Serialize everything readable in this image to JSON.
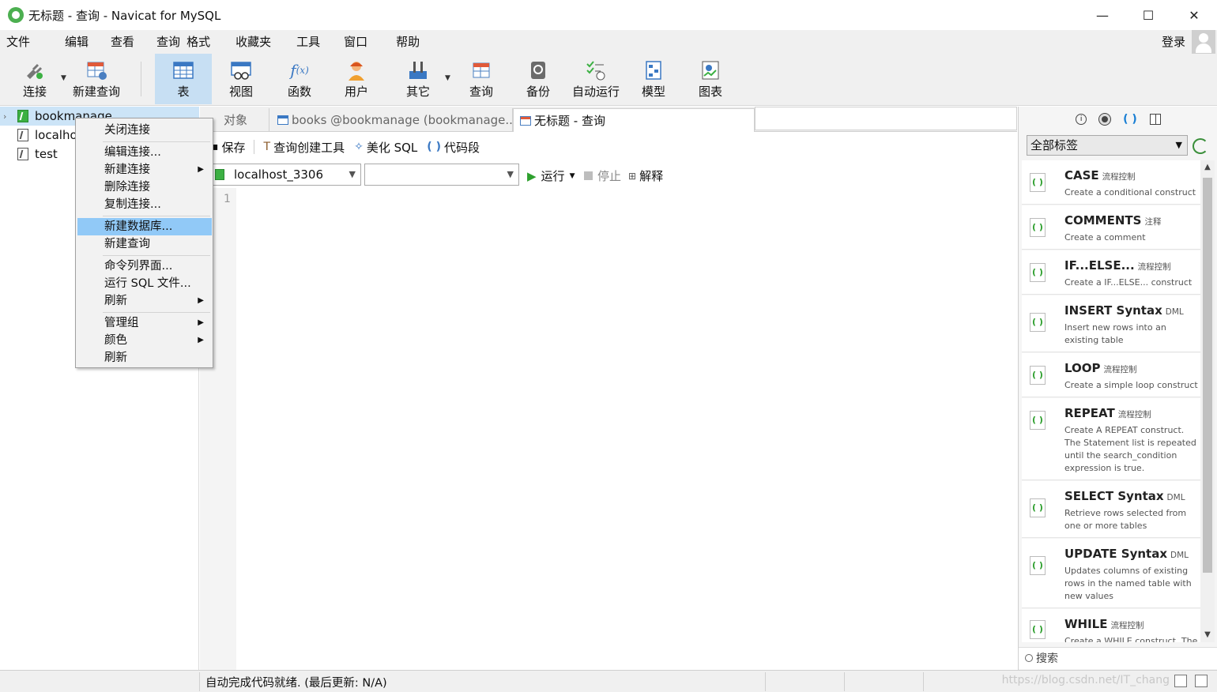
{
  "window": {
    "title": "无标题 - 查询 - Navicat for MySQL",
    "minimize": "—",
    "maximize": "☐",
    "close": "✕"
  },
  "menubar": {
    "items": [
      "文件",
      "编辑",
      "查看",
      "查询",
      "格式",
      "收藏夹",
      "工具",
      "窗口",
      "帮助"
    ],
    "login": "登录"
  },
  "toolbar": {
    "connect": "连接",
    "new_query": "新建查询",
    "table": "表",
    "view": "视图",
    "function": "函数",
    "user": "用户",
    "other": "其它",
    "query": "查询",
    "backup": "备份",
    "auto_run": "自动运行",
    "model": "模型",
    "chart": "图表"
  },
  "navigator": {
    "items": [
      {
        "label": "bookmanage",
        "selected": true,
        "connected": true
      },
      {
        "label": "localhost_3306",
        "selected": false,
        "connected": false
      },
      {
        "label": "test",
        "selected": false,
        "connected": false
      }
    ],
    "visible_label_1": "localho"
  },
  "context_menu": {
    "items": [
      "关闭连接",
      "编辑连接...",
      "新建连接",
      "删除连接",
      "复制连接...",
      "新建数据库...",
      "新建查询",
      "命令列界面...",
      "运行 SQL 文件...",
      "刷新",
      "管理组",
      "颜色",
      "刷新"
    ],
    "highlighted": "新建数据库..."
  },
  "tabs": {
    "objects": "对象",
    "books": "books @bookmanage (bookmanage...",
    "query": "无标题 - 查询"
  },
  "query_toolbar": {
    "save": "保存",
    "query_builder": "查询创建工具",
    "beautify": "美化 SQL",
    "snippet": "代码段"
  },
  "query_bar": {
    "connection": "localhost_3306",
    "database": "",
    "run": "运行",
    "stop": "停止",
    "explain": "解释"
  },
  "editor": {
    "line_number": "1"
  },
  "snippets_panel": {
    "filter": "全部标签",
    "search_placeholder": "搜索",
    "items": [
      {
        "title": "CASE",
        "category": "流程控制",
        "desc": "Create a conditional construct"
      },
      {
        "title": "COMMENTS",
        "category": "注释",
        "desc": "Create a comment"
      },
      {
        "title": "IF...ELSE...",
        "category": "流程控制",
        "desc": "Create a IF...ELSE... construct"
      },
      {
        "title": "INSERT Syntax",
        "category": "DML",
        "desc": "Insert new rows into an existing table"
      },
      {
        "title": "LOOP",
        "category": "流程控制",
        "desc": "Create a simple loop construct"
      },
      {
        "title": "REPEAT",
        "category": "流程控制",
        "desc": "Create A REPEAT construct. The Statement list is repeated until the search_condition expression is true."
      },
      {
        "title": "SELECT Syntax",
        "category": "DML",
        "desc": "Retrieve rows selected from one or more tables"
      },
      {
        "title": "UPDATE Syntax",
        "category": "DML",
        "desc": "Updates columns of existing rows in the named table with new values"
      },
      {
        "title": "WHILE",
        "category": "流程控制",
        "desc": "Create a WHILE construct. The"
      }
    ]
  },
  "statusbar": {
    "text": "自动完成代码就绪. (最后更新: N/A)",
    "watermark": "https://blog.csdn.net/IT_chang"
  },
  "colors": {
    "selection": "#cce4f7",
    "menu_highlight": "#91c9f7",
    "active_tool": "#c7dff3"
  }
}
